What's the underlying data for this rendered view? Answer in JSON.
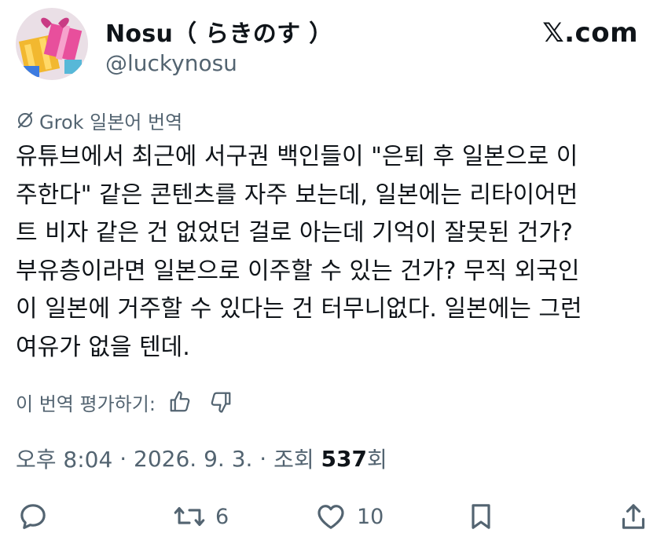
{
  "author": {
    "name": "Nosu（ らきのす ）",
    "handle": "@luckynosu"
  },
  "brand": "𝕏.com",
  "translation": {
    "label": "Grok 일본어 번역"
  },
  "tweet": {
    "lines": [
      "유튜브에서 최근에 서구권 백인들이 \"은퇴 후 일본으로 이",
      "주한다\" 같은 콘텐츠를 자주 보는데, 일본에는 리타이어먼",
      "트 비자 같은 건 없었던 걸로 아는데 기억이 잘못된 건가?",
      "부유층이라면 일본으로 이주할 수 있는 건가? 무직 외국인",
      "이 일본에 거주할 수 있다는 건 터무니없다. 일본에는 그런",
      "여유가 없을 텐데."
    ]
  },
  "rating": {
    "label": "이 번역 평가하기:"
  },
  "meta": {
    "time": "오후 8:04",
    "date": "2026. 9. 3.",
    "views_prefix": "조회",
    "views_count": "537",
    "views_suffix": "회"
  },
  "actions": {
    "reply_count": "",
    "retweet_count": "6",
    "like_count": "10"
  },
  "colors": {
    "text": "#0f1419",
    "secondary": "#536471",
    "background": "#ffffff"
  }
}
